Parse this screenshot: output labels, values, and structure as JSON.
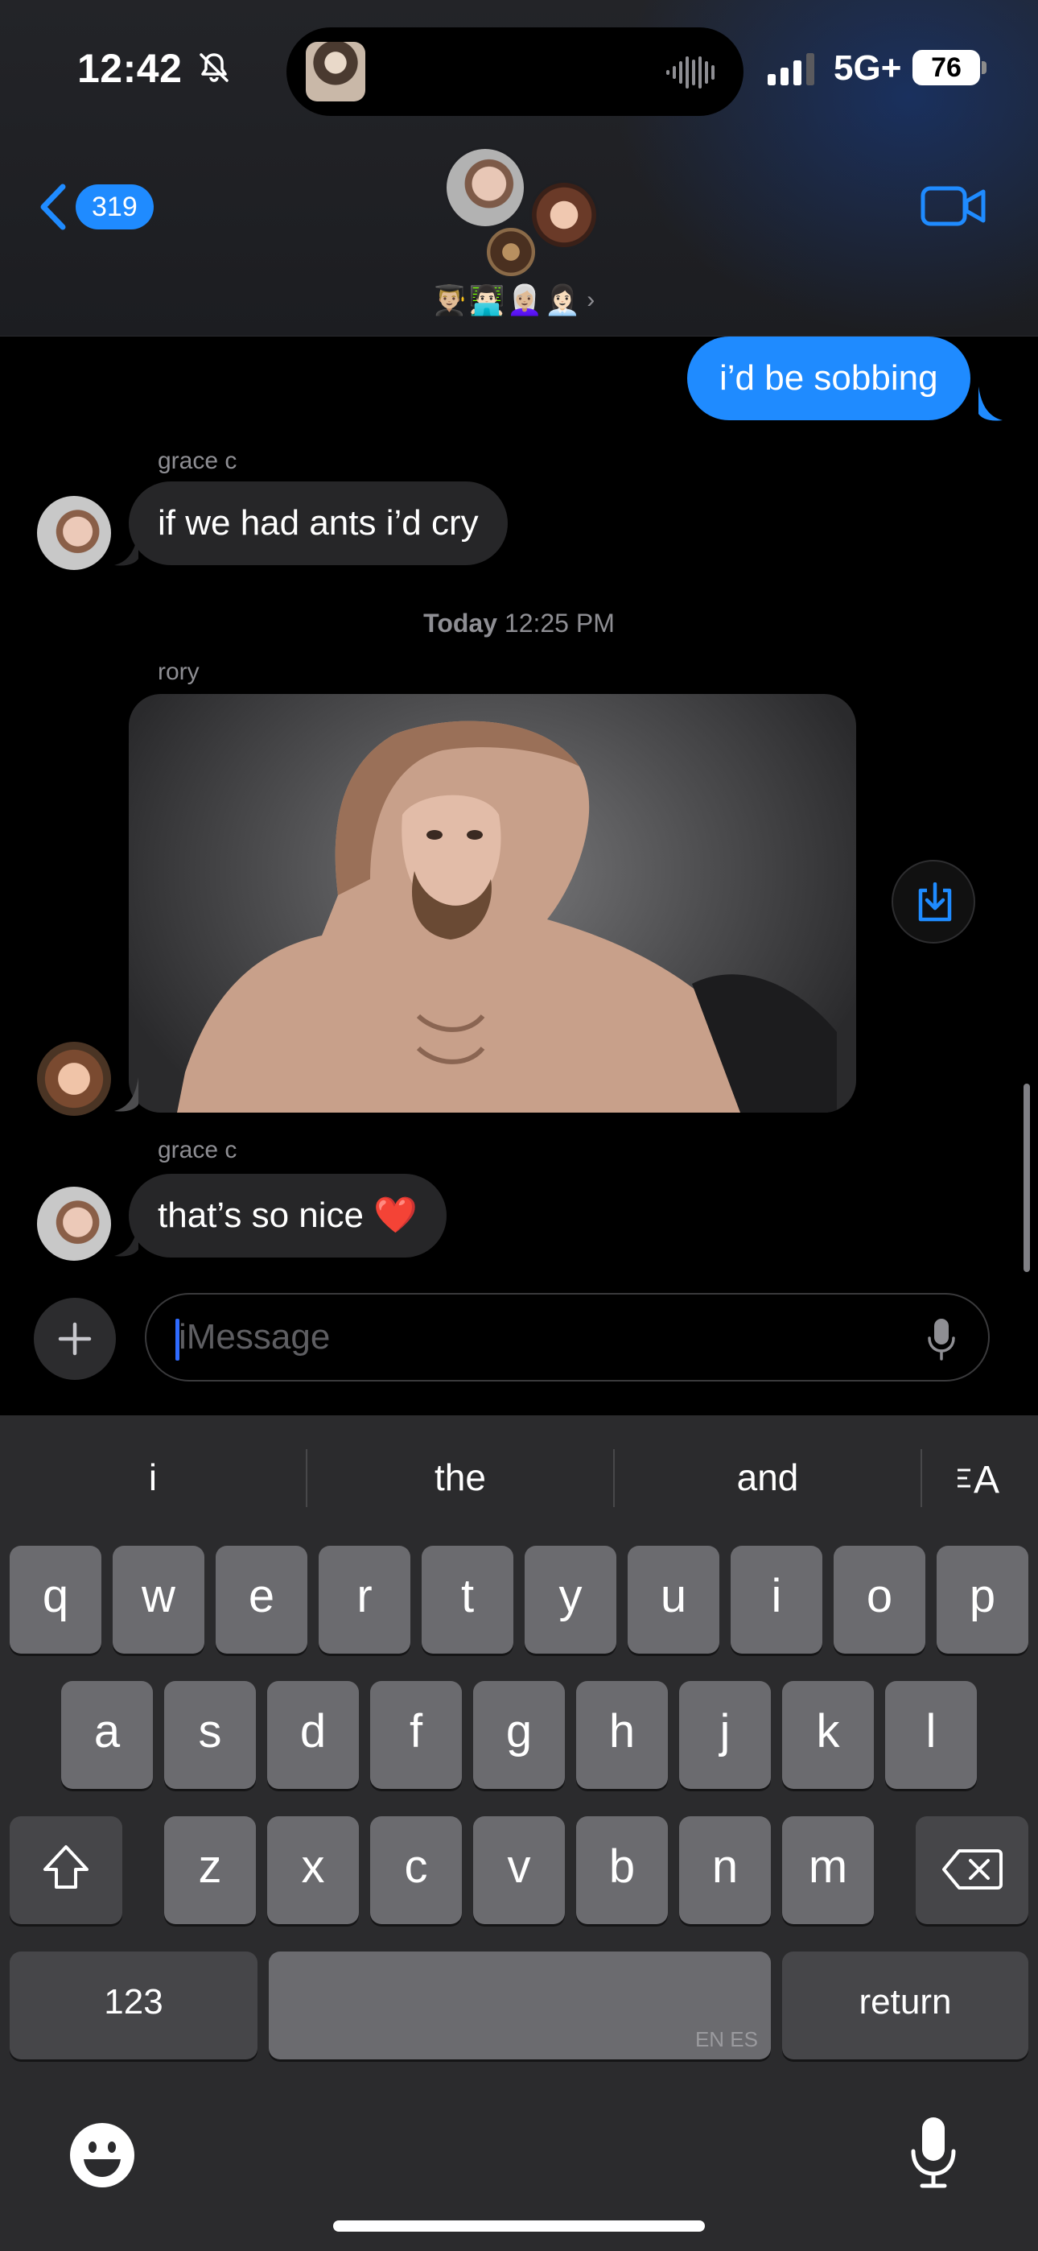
{
  "status_bar": {
    "time": "12:42",
    "network": "5G+",
    "battery": "76"
  },
  "header": {
    "back_count": "319",
    "member_emojis": "👨🏼‍🎓👨🏻‍💻👩🏼‍🦳👩🏻‍💼"
  },
  "messages": [
    {
      "type": "outgoing",
      "text": "i’d be sobbing"
    },
    {
      "type": "incoming",
      "sender": "grace c",
      "text": "if we had ants i’d cry"
    },
    {
      "type": "timestamp",
      "day": "Today",
      "time": "12:25 PM"
    },
    {
      "type": "incoming-photo",
      "sender": "rory"
    },
    {
      "type": "incoming",
      "sender": "grace c",
      "text": "that’s so nice ❤️"
    }
  ],
  "composer": {
    "placeholder": "iMessage",
    "value": ""
  },
  "keyboard": {
    "suggestions": [
      "i",
      "the",
      "and"
    ],
    "row1": [
      "q",
      "w",
      "e",
      "r",
      "t",
      "y",
      "u",
      "i",
      "o",
      "p"
    ],
    "row2": [
      "a",
      "s",
      "d",
      "f",
      "g",
      "h",
      "j",
      "k",
      "l"
    ],
    "row3": [
      "z",
      "x",
      "c",
      "v",
      "b",
      "n",
      "m"
    ],
    "numbers_label": "123",
    "return_label": "return",
    "language_tag": "EN ES"
  },
  "icons": {
    "back": "chevron-left-icon",
    "video": "video-camera-icon",
    "share": "save-download-icon",
    "plus": "plus-icon",
    "mic": "microphone-icon",
    "emoji": "emoji-icon",
    "shift": "shift-icon",
    "delete": "delete-icon"
  },
  "colors": {
    "accent": "#1f8bff",
    "incoming_bubble": "#262628",
    "background": "#000000",
    "keyboard": "#2b2b2d",
    "key": "#6b6b6f"
  }
}
